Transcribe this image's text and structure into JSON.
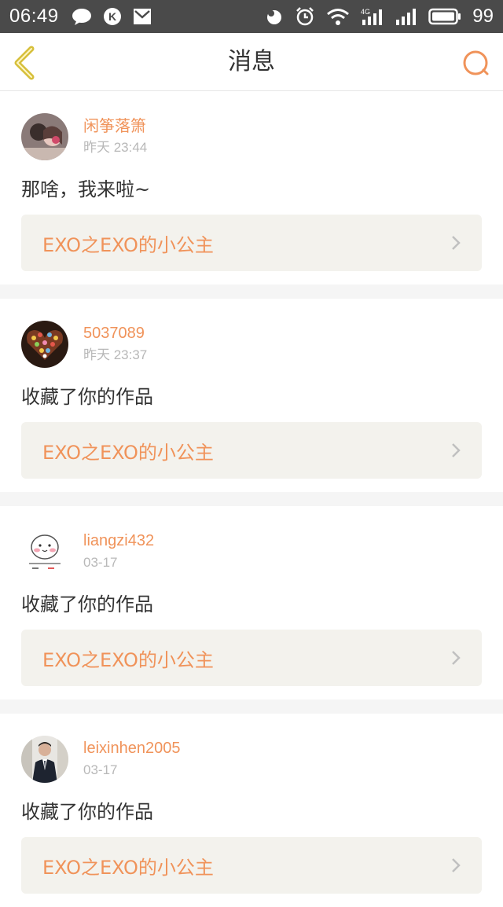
{
  "status_bar": {
    "time": "06:49",
    "battery": "99",
    "network_label": "4G"
  },
  "header": {
    "title": "消息"
  },
  "messages": [
    {
      "username": "闲筝落箫",
      "time": "昨天 23:44",
      "text": "那啥，我来啦~",
      "work_title": "EXO之EXO的小公主"
    },
    {
      "username": "5037089",
      "time": "昨天 23:37",
      "text": "收藏了你的作品",
      "work_title": "EXO之EXO的小公主"
    },
    {
      "username": "liangzi432",
      "time": "03-17",
      "text": "收藏了你的作品",
      "work_title": "EXO之EXO的小公主"
    },
    {
      "username": "leixinhen2005",
      "time": "03-17",
      "text": "收藏了你的作品",
      "work_title": "EXO之EXO的小公主"
    }
  ],
  "colors": {
    "accent": "#f0935a",
    "back_icon": "#d6bf3a",
    "status_bar": "#4a4a4a"
  }
}
